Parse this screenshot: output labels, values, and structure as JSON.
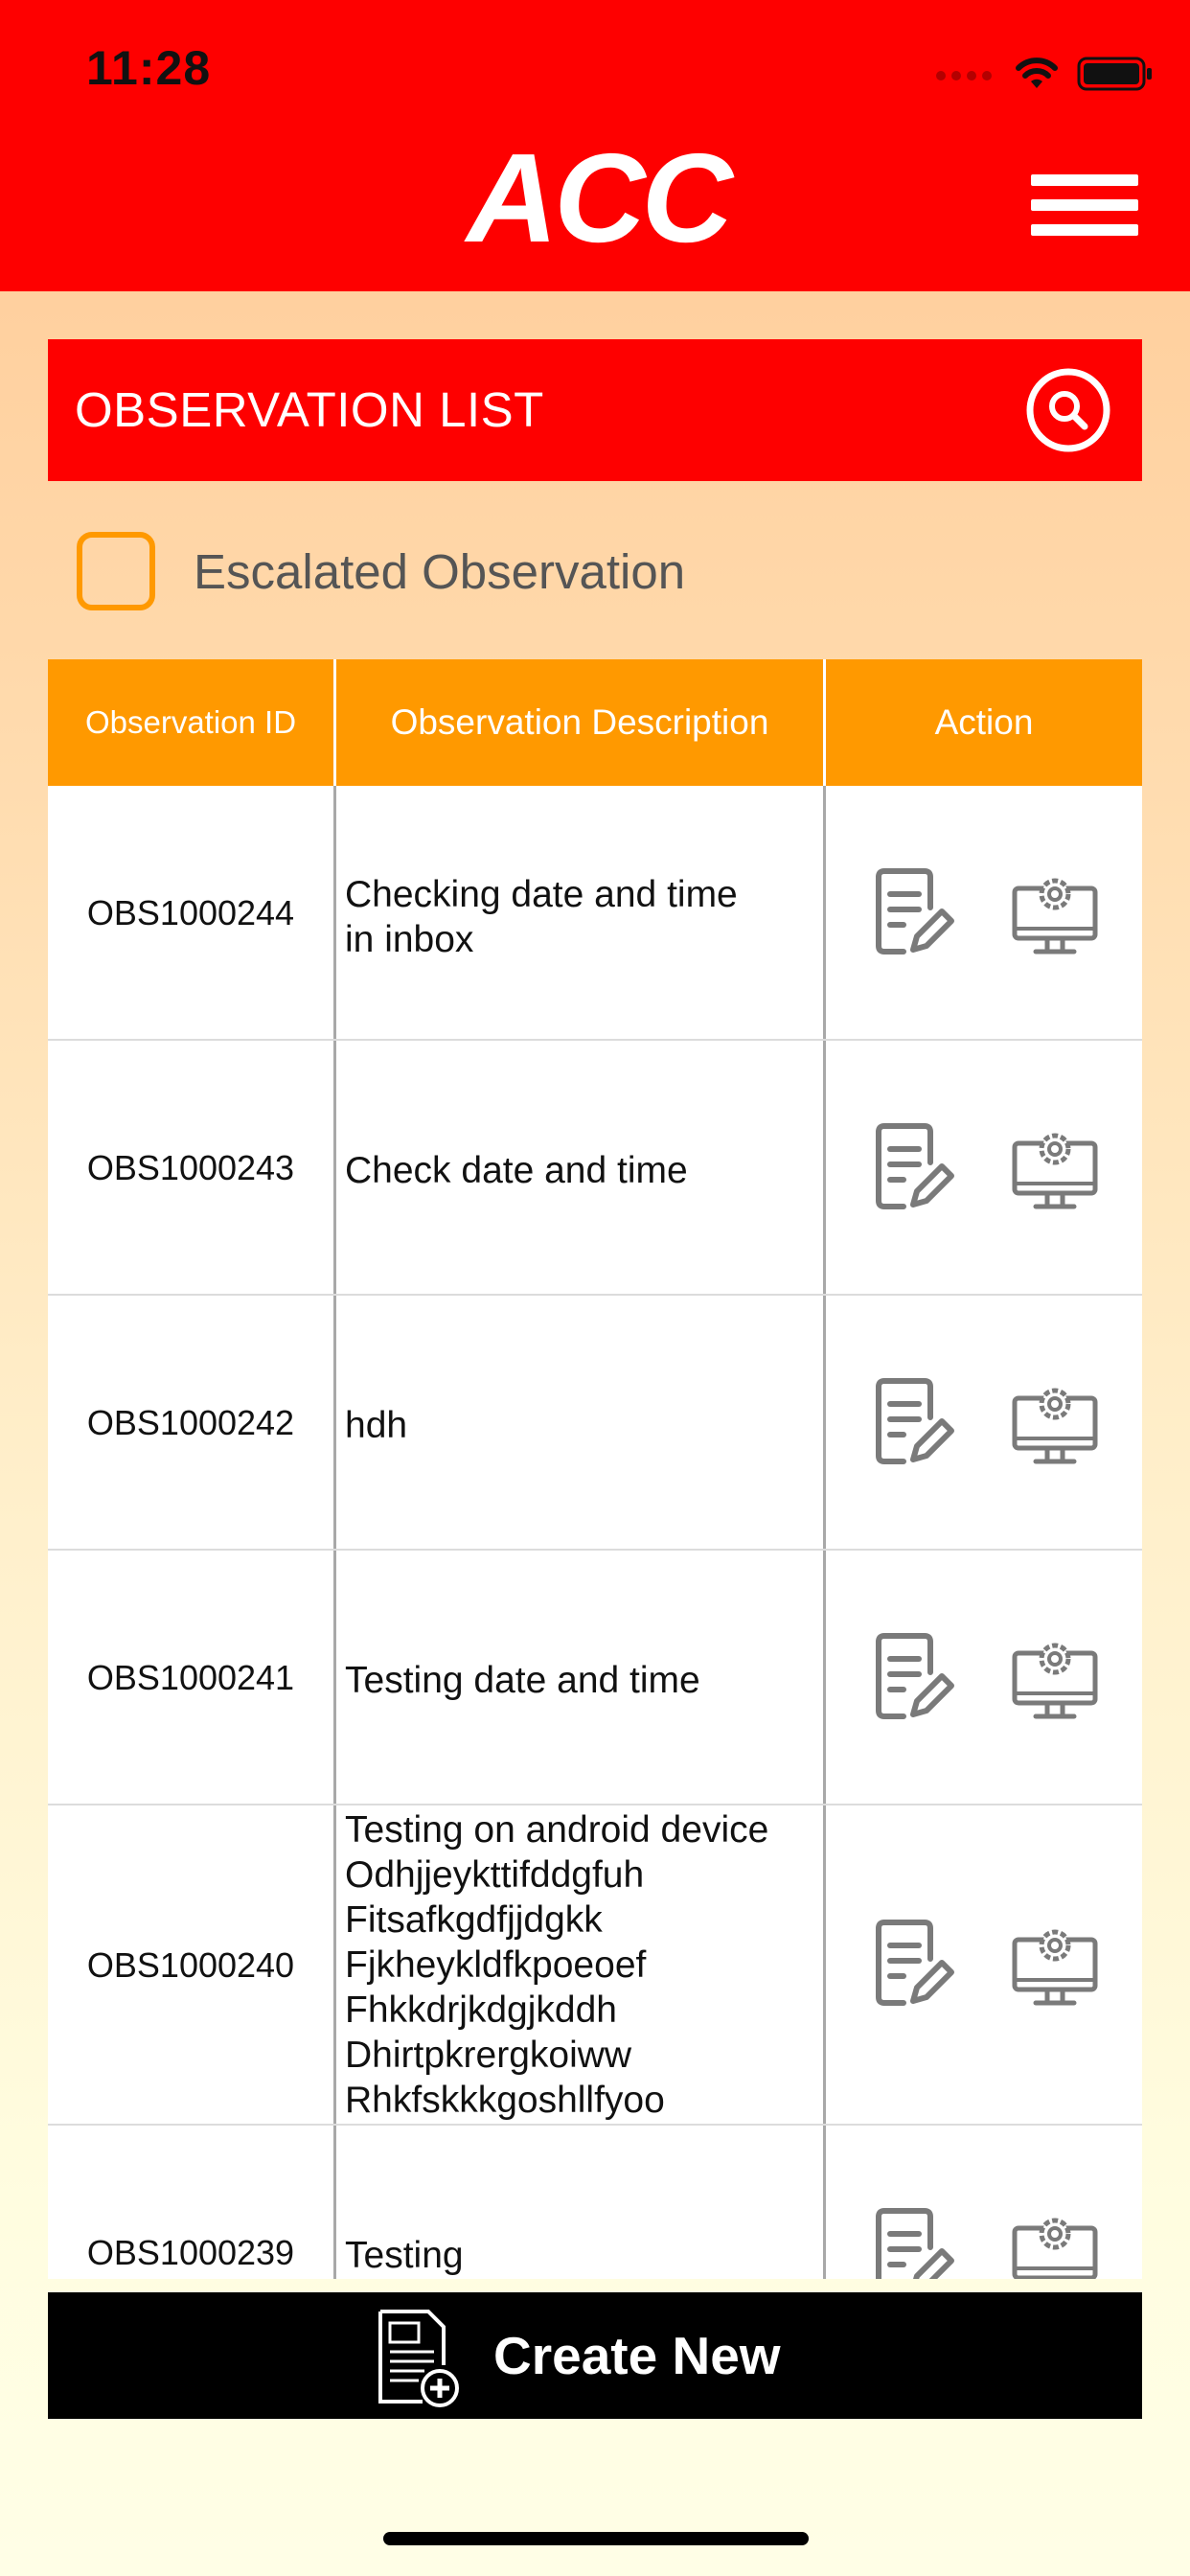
{
  "status_bar": {
    "time": "11:28"
  },
  "header": {
    "logo_text": "ACC",
    "menu_icon": "hamburger-menu-icon"
  },
  "title_bar": {
    "title": "OBSERVATION LIST",
    "search_icon": "search-icon"
  },
  "filter": {
    "escalated_label": "Escalated Observation",
    "escalated_checked": false
  },
  "table": {
    "columns": [
      "Observation ID",
      "Observation Description",
      "Action"
    ],
    "rows": [
      {
        "id": "OBS1000244",
        "description": [
          "Checking date and time",
          "in inbox"
        ]
      },
      {
        "id": "OBS1000243",
        "description": [
          "Check date and time"
        ]
      },
      {
        "id": "OBS1000242",
        "description": [
          "hdh"
        ]
      },
      {
        "id": "OBS1000241",
        "description": [
          "Testing date and time"
        ]
      },
      {
        "id": "OBS1000240",
        "description": [
          "Testing on android device",
          "Odhjjeykttifddgfuh",
          "Fitsafkgdfjjdgkk",
          "Fjkheykldfkpoeoef",
          "Fhkkdrjkdgjkddh",
          "Dhirtpkrergkoiww",
          "Rhkfskkkgoshllfyoo"
        ]
      },
      {
        "id": "OBS1000239",
        "description": [
          "Testing"
        ]
      }
    ],
    "action_icons": [
      "edit-document-icon",
      "monitor-settings-icon"
    ]
  },
  "footer": {
    "create_label": "Create New",
    "create_icon": "new-document-icon"
  },
  "colors": {
    "header_red": "#fe0000",
    "accent_orange": "#ff9900",
    "button_black": "#000000"
  }
}
